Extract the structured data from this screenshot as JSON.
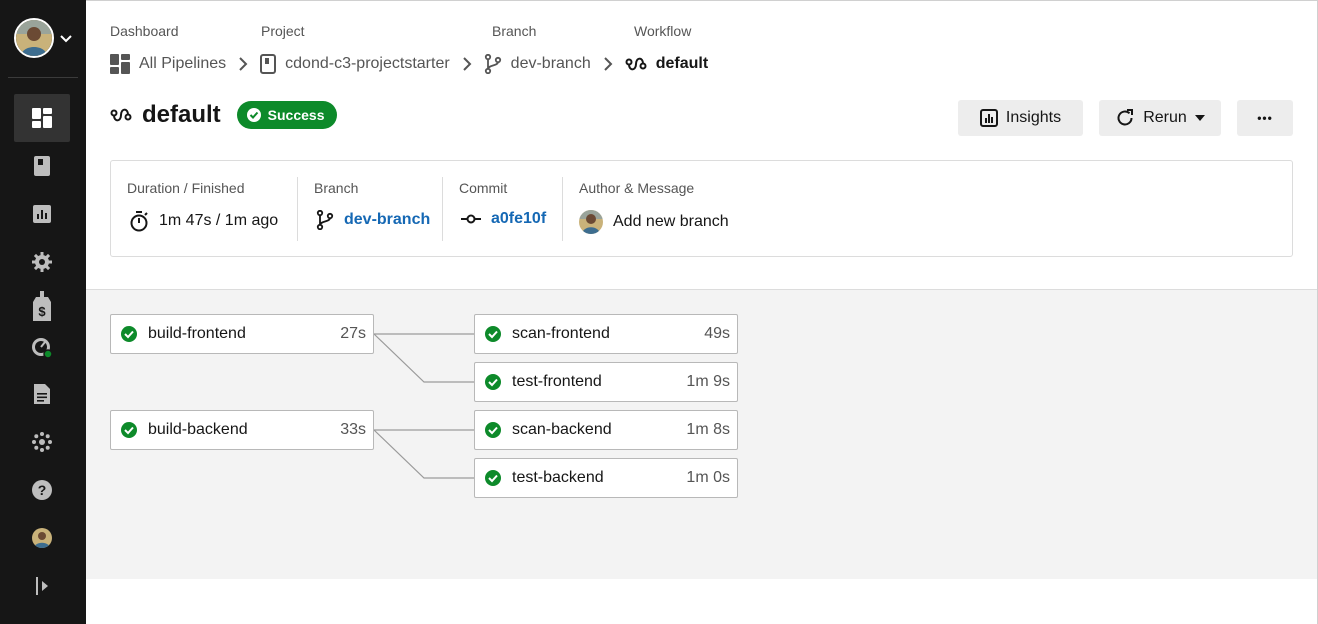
{
  "sidebar": {
    "user_icon": "avatar",
    "items": [
      {
        "name": "dashboard-icon",
        "active": true
      },
      {
        "name": "projects-icon"
      },
      {
        "name": "insights-icon"
      },
      {
        "name": "settings-icon"
      },
      {
        "name": "plan-icon"
      },
      {
        "name": "status-icon"
      },
      {
        "name": "docs-icon"
      },
      {
        "name": "integrations-icon"
      },
      {
        "name": "help-icon"
      },
      {
        "name": "profile-avatar"
      },
      {
        "name": "expand-sidebar-icon"
      }
    ]
  },
  "breadcrumb": {
    "labels": {
      "dashboard": "Dashboard",
      "project": "Project",
      "branch": "Branch",
      "workflow": "Workflow"
    },
    "all_pipelines": "All Pipelines",
    "project": "cdond-c3-projectstarter",
    "branch": "dev-branch",
    "workflow": "default"
  },
  "header": {
    "title": "default",
    "status": "Success",
    "insights_label": "Insights",
    "rerun_label": "Rerun",
    "more_label": "•••"
  },
  "info": {
    "duration_label": "Duration / Finished",
    "duration_value": "1m 47s / 1m ago",
    "branch_label": "Branch",
    "branch_value": "dev-branch",
    "commit_label": "Commit",
    "commit_value": "a0fe10f",
    "author_label": "Author & Message",
    "message": "Add new branch"
  },
  "jobs": [
    {
      "name": "build-frontend",
      "duration": "27s"
    },
    {
      "name": "scan-frontend",
      "duration": "49s"
    },
    {
      "name": "test-frontend",
      "duration": "1m 9s"
    },
    {
      "name": "build-backend",
      "duration": "33s"
    },
    {
      "name": "scan-backend",
      "duration": "1m 8s"
    },
    {
      "name": "test-backend",
      "duration": "1m 0s"
    }
  ],
  "colors": {
    "success": "#0d8a2a",
    "link": "#1568b4",
    "sidebar": "#161616"
  }
}
